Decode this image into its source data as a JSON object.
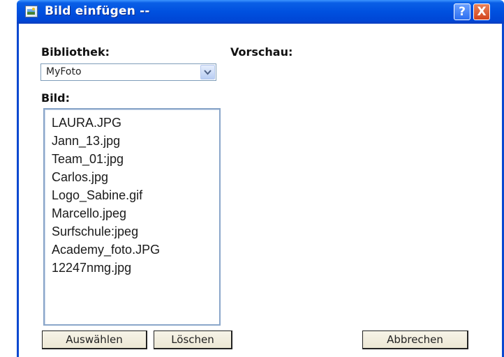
{
  "window": {
    "title": "Bild einfügen --",
    "help_label": "?",
    "close_label": "X",
    "icon": "app-image-icon"
  },
  "labels": {
    "bibliothek": "Bibliothek:",
    "vorschau": "Vorschau:",
    "bild": "Bild:"
  },
  "library_select": {
    "value": "MyFoto",
    "icon": "chevron-down-icon"
  },
  "files": [
    "LAURA.JPG",
    "Jann_13.jpg",
    "Team_01:jpg",
    "Carlos.jpg",
    "Logo_Sabine.gif",
    "Marcello.jpeg",
    "Surfschule:jpeg",
    "Academy_foto.JPG",
    "12247nmg.jpg"
  ],
  "buttons": {
    "select": "Auswählen",
    "delete": "Löschen",
    "cancel": "Abbrechen"
  },
  "colors": {
    "titlebar": "#0050df",
    "close": "#d3441c",
    "button_face": "#ece7d4"
  }
}
